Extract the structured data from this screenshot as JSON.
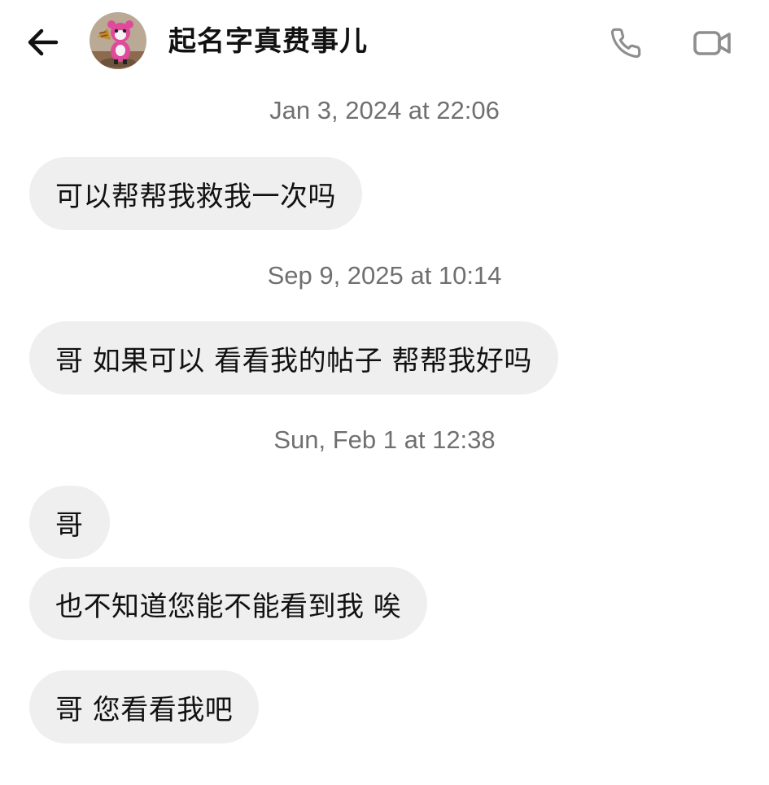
{
  "header": {
    "back_icon": "arrow-left-icon",
    "avatar_icon": "cartoon-avatar",
    "contact_name": "起名字真费事儿",
    "call_icon": "phone-icon",
    "video_icon": "video-camera-icon"
  },
  "conversation": {
    "groups": [
      {
        "timestamp": "Jan 3, 2024 at 22:06",
        "messages": [
          "可以帮帮我救我一次吗"
        ]
      },
      {
        "timestamp": "Sep 9, 2025 at 10:14",
        "messages": [
          "哥 如果可以 看看我的帖子 帮帮我好吗"
        ]
      },
      {
        "timestamp": "Sun, Feb 1 at 12:38",
        "messages": [
          "哥",
          "也不知道您能不能看到我 唉",
          "哥 您看看我吧"
        ]
      }
    ]
  },
  "colors": {
    "bubble_background": "#efefef",
    "timestamp_text": "#707070",
    "icon_gray": "#8e8e8e",
    "text": "#111111"
  }
}
